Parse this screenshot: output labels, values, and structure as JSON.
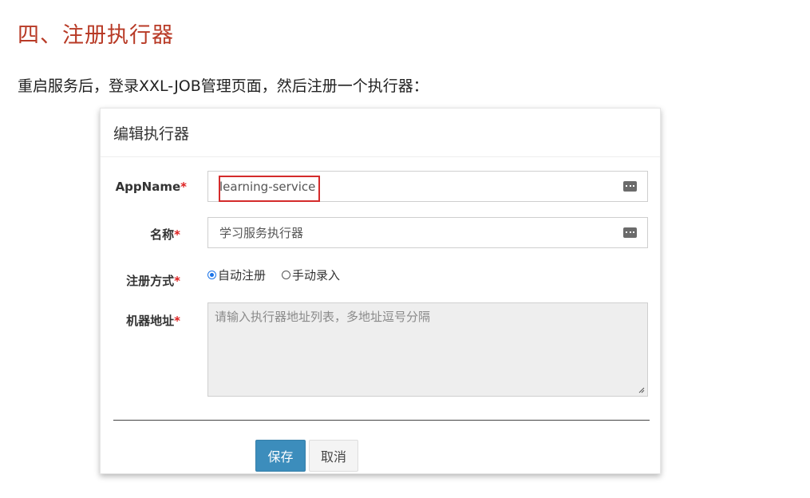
{
  "heading": "四、注册执行器",
  "intro": "重启服务后，登录XXL-JOB管理页面，然后注册一个执行器：",
  "modal": {
    "title": "编辑执行器",
    "fields": {
      "appname": {
        "label": "AppName",
        "required": "*",
        "value": "learning-service"
      },
      "name": {
        "label": "名称",
        "required": "*",
        "value": "学习服务执行器"
      },
      "register_type": {
        "label": "注册方式",
        "required": "*",
        "options": [
          {
            "label": "自动注册",
            "checked": true
          },
          {
            "label": "手动录入",
            "checked": false
          }
        ]
      },
      "address": {
        "label": "机器地址",
        "required": "*",
        "placeholder": "请输入执行器地址列表，多地址逗号分隔"
      }
    },
    "buttons": {
      "save": "保存",
      "cancel": "取消"
    }
  },
  "icons": {
    "input_addon": "keyboard-icon",
    "textarea_resize": "resize-handle-icon"
  },
  "colors": {
    "heading": "#b83a26",
    "highlight": "#d42b2b",
    "primary_button": "#3c8dbc",
    "required": "#dd1f1f"
  }
}
